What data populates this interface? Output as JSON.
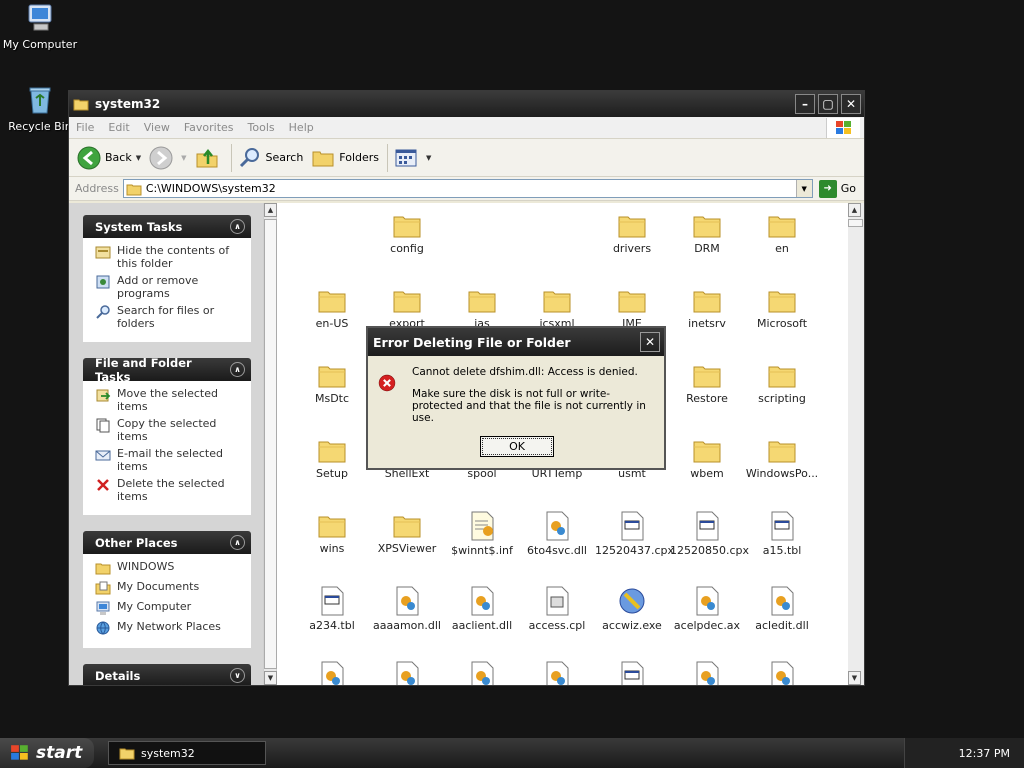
{
  "desktop": {
    "icons": [
      {
        "label": "My Computer"
      },
      {
        "label": "Recycle Bin"
      }
    ]
  },
  "window": {
    "title": "system32",
    "menu": [
      "File",
      "Edit",
      "View",
      "Favorites",
      "Tools",
      "Help"
    ],
    "toolbar": {
      "back": "Back",
      "search": "Search",
      "folders": "Folders"
    },
    "address": {
      "label": "Address",
      "value": "C:\\WINDOWS\\system32",
      "go": "Go"
    }
  },
  "taskpane": {
    "system_tasks": {
      "title": "System Tasks",
      "items": [
        "Hide the contents of this folder",
        "Add or remove programs",
        "Search for files or folders"
      ]
    },
    "file_tasks": {
      "title": "File and Folder Tasks",
      "items": [
        "Move the selected items",
        "Copy the selected items",
        "E-mail the selected items",
        "Delete the selected items"
      ]
    },
    "other_places": {
      "title": "Other Places",
      "items": [
        "WINDOWS",
        "My Documents",
        "My Computer",
        "My Network Places"
      ]
    },
    "details": {
      "title": "Details"
    }
  },
  "files": {
    "row1": [
      "config",
      "drivers",
      "DRM",
      "en"
    ],
    "row2": [
      "en-US",
      "export",
      "ias",
      "icsxml",
      "IME",
      "inetsrv",
      "Microsoft"
    ],
    "row3": [
      "MsDtc",
      "Restore",
      "scripting"
    ],
    "row4": [
      "Setup",
      "ShellExt",
      "spool",
      "URTTemp",
      "usmt",
      "wbem",
      "WindowsPo..."
    ],
    "row5": [
      "wins",
      "XPSViewer",
      "$winnt$.inf",
      "6to4svc.dll",
      "12520437.cpx",
      "12520850.cpx",
      "a15.tbl"
    ],
    "row6": [
      "a234.tbl",
      "aaaamon.dll",
      "aaclient.dll",
      "access.cpl",
      "accwiz.exe",
      "acelpdec.ax",
      "acledit.dll"
    ]
  },
  "dialog": {
    "title": "Error Deleting File or Folder",
    "message1": "Cannot delete dfshim.dll: Access is denied.",
    "message2": "Make sure the disk is not full or write-protected and that the file is not currently in use.",
    "ok": "OK"
  },
  "taskbar": {
    "start": "start",
    "task": "system32",
    "clock": "12:37 PM"
  }
}
